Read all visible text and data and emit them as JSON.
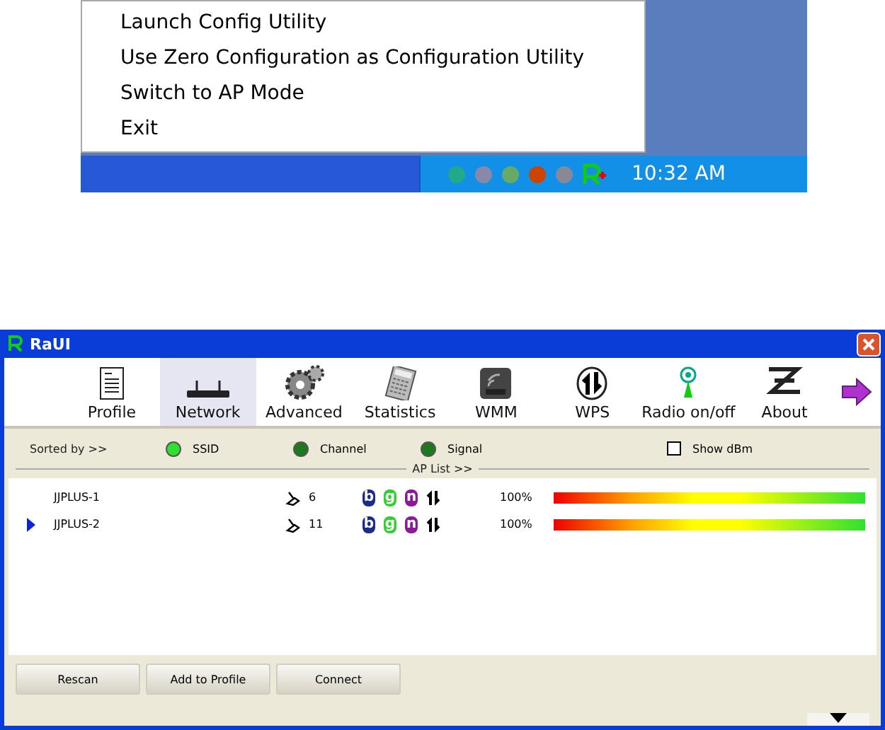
{
  "context_menu": {
    "items": [
      {
        "label": "Launch Config Utility"
      },
      {
        "label": "Use Zero Configuration as Configuration Utility"
      },
      {
        "label": "Switch to AP Mode"
      },
      {
        "label": "Exit"
      }
    ]
  },
  "taskbar": {
    "clock": "10:32 AM"
  },
  "window": {
    "title": "RaUI"
  },
  "toolbar": [
    {
      "label": "Profile",
      "selected": false,
      "kind": "profile"
    },
    {
      "label": "Network",
      "selected": true,
      "kind": "network"
    },
    {
      "label": "Advanced",
      "selected": false,
      "kind": "advanced"
    },
    {
      "label": "Statistics",
      "selected": false,
      "kind": "statistics"
    },
    {
      "label": "WMM",
      "selected": false,
      "kind": "wmm"
    },
    {
      "label": "WPS",
      "selected": false,
      "kind": "wps"
    },
    {
      "label": "Radio on/off",
      "selected": false,
      "kind": "radio"
    },
    {
      "label": "About",
      "selected": false,
      "kind": "about"
    }
  ],
  "sort": {
    "label": "Sorted by >>",
    "options": [
      {
        "label": "SSID",
        "selected": true
      },
      {
        "label": "Channel",
        "selected": false
      },
      {
        "label": "Signal",
        "selected": false
      }
    ],
    "show_dbm": {
      "label": "Show dBm",
      "checked": false
    }
  },
  "ap_list": {
    "title": "AP List >>",
    "rows": [
      {
        "ssid": "JJPLUS-1",
        "channel": "6",
        "modes": [
          "b",
          "g",
          "n"
        ],
        "signal": "100%",
        "level": 1,
        "selected": false
      },
      {
        "ssid": "JJPLUS-2",
        "channel": "11",
        "modes": [
          "b",
          "g",
          "n"
        ],
        "signal": "100%",
        "level": 1,
        "selected": true
      }
    ]
  },
  "buttons": [
    "Rescan",
    "Add to Profile",
    "Connect"
  ]
}
